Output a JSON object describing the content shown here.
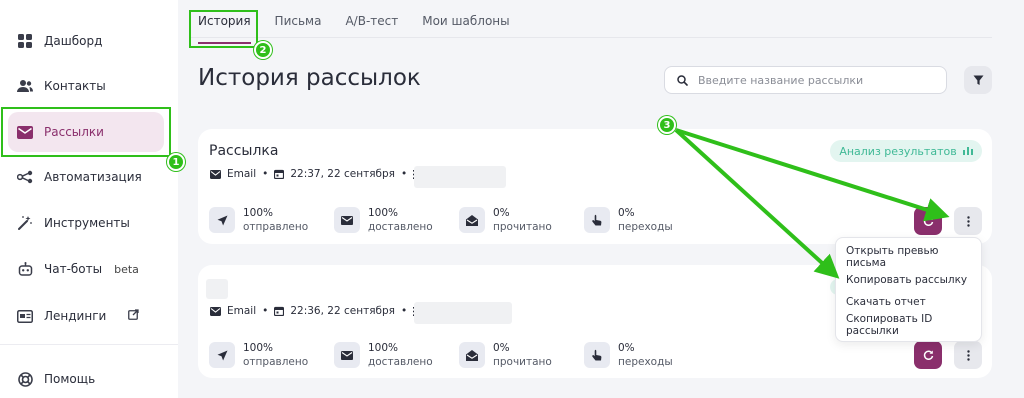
{
  "sidebar": {
    "items": [
      {
        "label": "Дашборд",
        "icon": "grid-icon"
      },
      {
        "label": "Контакты",
        "icon": "users-icon"
      },
      {
        "label": "Рассылки",
        "icon": "mail-icon",
        "active": true
      },
      {
        "label": "Автоматизация",
        "icon": "automation-icon"
      },
      {
        "label": "Инструменты",
        "icon": "magic-wand-icon"
      },
      {
        "label": "Чат-боты",
        "icon": "bot-icon",
        "badge": "beta"
      },
      {
        "label": "Лендинги",
        "icon": "landing-icon"
      }
    ],
    "help_label": "Помощь"
  },
  "tabs": [
    {
      "label": "История"
    },
    {
      "label": "Письма"
    },
    {
      "label": "A/B-тест"
    },
    {
      "label": "Мои шаблоны"
    }
  ],
  "page_title": "История рассылок",
  "search": {
    "placeholder": "Введите название рассылки"
  },
  "cards": [
    {
      "title": "Рассылка",
      "channel": "Email",
      "datetime": "22:37, 22 сентября",
      "analysis_label": "Анализ результатов",
      "stats": [
        {
          "value": "100%",
          "label": "отправлено"
        },
        {
          "value": "100%",
          "label": "доставлено"
        },
        {
          "value": "0%",
          "label": "прочитано"
        },
        {
          "value": "0%",
          "label": "переходы"
        }
      ]
    },
    {
      "title": "",
      "channel": "Email",
      "datetime": "22:36, 22 сентября",
      "stats": [
        {
          "value": "100%",
          "label": "отправлено"
        },
        {
          "value": "100%",
          "label": "доставлено"
        },
        {
          "value": "0%",
          "label": "прочитано"
        },
        {
          "value": "0%",
          "label": "переходы"
        }
      ]
    }
  ],
  "dropdown_menu": {
    "items": [
      "Открыть превью письма",
      "Копировать рассылку",
      "Скачать отчет",
      "Скопировать ID рассылки"
    ]
  },
  "annotations": {
    "badges": [
      "1",
      "2",
      "3"
    ],
    "color": "#2fbf1a"
  },
  "colors": {
    "accent": "#8a2f6c",
    "active_bg": "#f3e6ef",
    "success": "#40b996",
    "annotation": "#2fbf1a"
  }
}
